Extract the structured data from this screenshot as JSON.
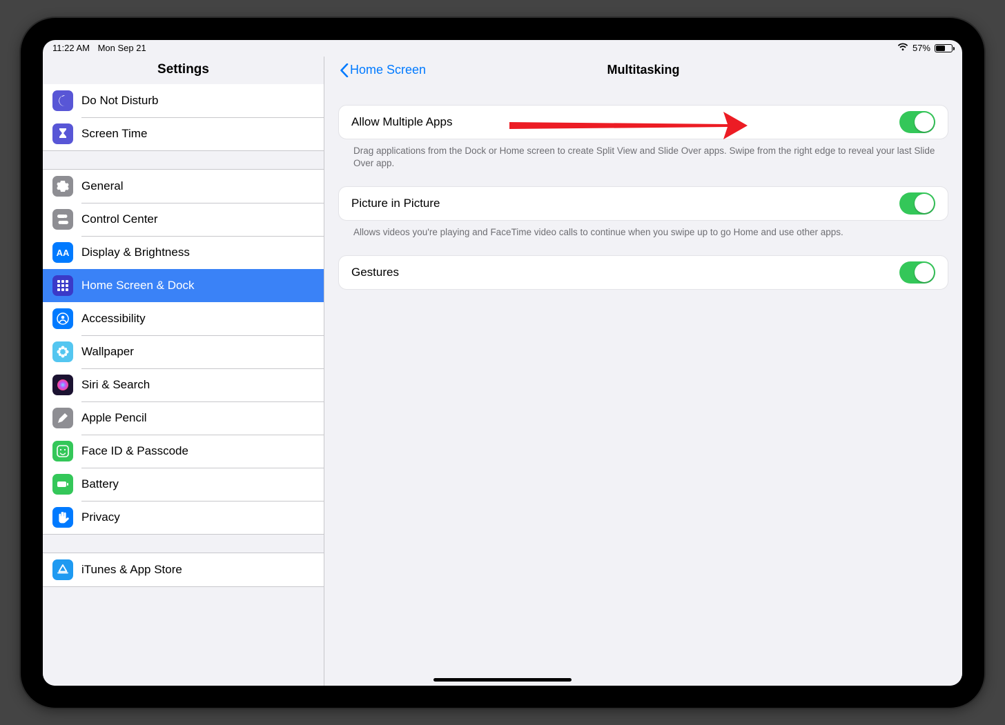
{
  "status": {
    "time": "11:22 AM",
    "date": "Mon Sep 21",
    "battery_pct": "57%"
  },
  "sidebar": {
    "title": "Settings",
    "groups": [
      {
        "items": [
          {
            "id": "dnd",
            "label": "Do Not Disturb",
            "icon": "moon",
            "bg": "#5856d6"
          },
          {
            "id": "screentime",
            "label": "Screen Time",
            "icon": "hourglass",
            "bg": "#5856d6"
          }
        ]
      },
      {
        "items": [
          {
            "id": "general",
            "label": "General",
            "icon": "gear",
            "bg": "#8e8e93"
          },
          {
            "id": "controlcenter",
            "label": "Control Center",
            "icon": "toggles",
            "bg": "#8e8e93"
          },
          {
            "id": "display",
            "label": "Display & Brightness",
            "icon": "aa",
            "bg": "#007aff"
          },
          {
            "id": "homescreen",
            "label": "Home Screen & Dock",
            "icon": "grid",
            "bg": "#3a3ac8",
            "selected": true
          },
          {
            "id": "accessibility",
            "label": "Accessibility",
            "icon": "person",
            "bg": "#007aff"
          },
          {
            "id": "wallpaper",
            "label": "Wallpaper",
            "icon": "flower",
            "bg": "#54c6f0"
          },
          {
            "id": "siri",
            "label": "Siri & Search",
            "icon": "siri",
            "bg": "#1b1231"
          },
          {
            "id": "applepencil",
            "label": "Apple Pencil",
            "icon": "pencil",
            "bg": "#8e8e93"
          },
          {
            "id": "faceid",
            "label": "Face ID & Passcode",
            "icon": "face",
            "bg": "#34c759"
          },
          {
            "id": "battery",
            "label": "Battery",
            "icon": "batt",
            "bg": "#34c759"
          },
          {
            "id": "privacy",
            "label": "Privacy",
            "icon": "hand",
            "bg": "#007aff"
          }
        ]
      },
      {
        "items": [
          {
            "id": "itunes",
            "label": "iTunes & App Store",
            "icon": "appstore",
            "bg": "#1e9af1"
          }
        ]
      }
    ]
  },
  "detail": {
    "back_label": "Home Screen",
    "title": "Multitasking",
    "sections": [
      {
        "id": "allow-multiple-apps",
        "label": "Allow Multiple Apps",
        "on": true,
        "footer": "Drag applications from the Dock or Home screen to create Split View and Slide Over apps. Swipe from the right edge to reveal your last Slide Over app."
      },
      {
        "id": "pip",
        "label": "Picture in Picture",
        "on": true,
        "footer": "Allows videos you're playing and FaceTime video calls to continue when you swipe up to go Home and use other apps."
      },
      {
        "id": "gestures",
        "label": "Gestures",
        "on": true,
        "footer": ""
      }
    ]
  },
  "colors": {
    "accent": "#007aff",
    "toggle_on": "#34c759",
    "selected": "#3a82f7",
    "annotation": "#ec1c24"
  }
}
